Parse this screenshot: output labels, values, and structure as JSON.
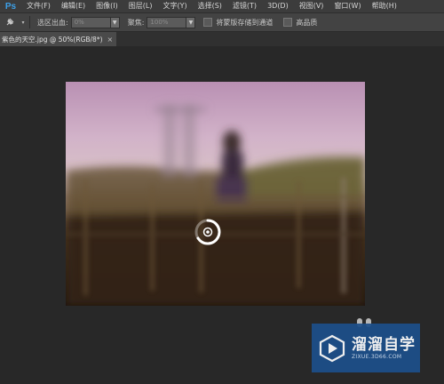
{
  "app": {
    "logo": "Ps",
    "accent": "#3da0e8"
  },
  "menu": [
    "文件(F)",
    "编辑(E)",
    "图像(I)",
    "图层(L)",
    "文字(Y)",
    "选择(S)",
    "滤镜(T)",
    "3D(D)",
    "视图(V)",
    "窗口(W)",
    "帮助(H)"
  ],
  "options": {
    "tool_icon": "pin-icon",
    "selection_output_label": "选区出血:",
    "selection_output_value": "0%",
    "focus_label": "聚焦:",
    "focus_value": "100%",
    "save_mask_label": "将蒙版存储到通道",
    "high_quality_label": "高品质"
  },
  "document_tab": {
    "title": "紫色的天空.jpg @ 50%(RGB/8*)",
    "close": "×"
  },
  "watermark": {
    "name": "溜溜自学",
    "url": "ZIXUE.3D66.COM",
    "color": "#1d4f8a"
  }
}
